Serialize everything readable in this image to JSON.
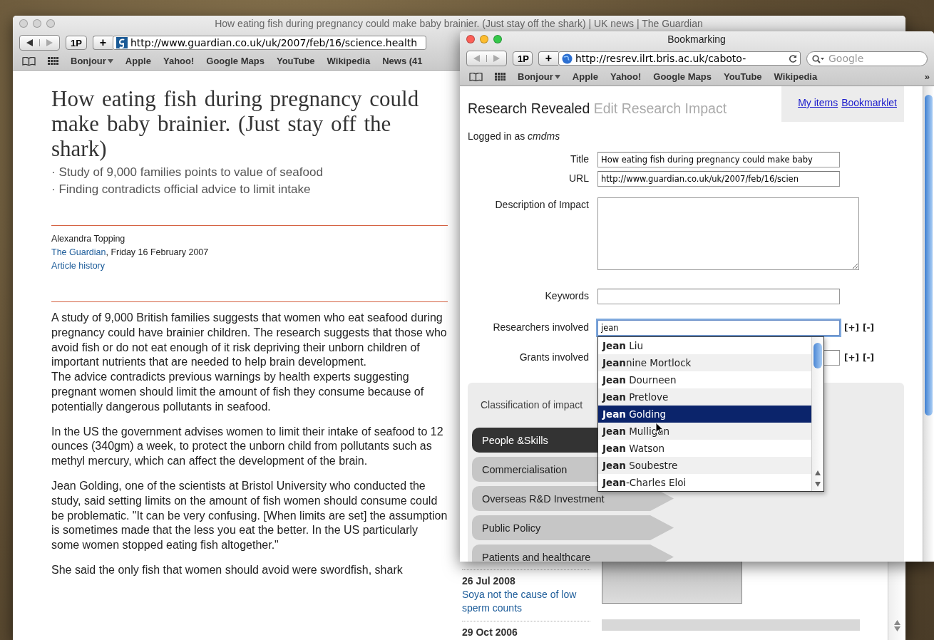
{
  "back_window": {
    "title": "How eating fish during pregnancy could make baby brainier. (Just stay off the shark) | UK news | The Guardian",
    "active": false,
    "toolbar": {
      "password_button": "1P",
      "add_button": "+",
      "url": "http://www.guardian.co.uk/uk/2007/feb/16/science.health",
      "bookmarks": [
        {
          "label": "Bonjour",
          "kind": "menu"
        },
        {
          "label": "Apple",
          "kind": "link"
        },
        {
          "label": "Yahoo!",
          "kind": "link"
        },
        {
          "label": "Google Maps",
          "kind": "link"
        },
        {
          "label": "YouTube",
          "kind": "link"
        },
        {
          "label": "Wikipedia",
          "kind": "link"
        },
        {
          "label": "News (41",
          "kind": "link"
        }
      ]
    },
    "page": {
      "headline": "How eating fish during pregnancy could make baby brainier. (Just stay off the shark)",
      "standfirst": [
        "· Study of 9,000 families points to value of seafood",
        "· Finding contradicts official advice to limit intake"
      ],
      "byline": {
        "author": "Alexandra Topping",
        "publication": "The Guardian",
        "date": ", Friday 16 February 2007",
        "history_link": "Article history"
      },
      "paragraphs": [
        [
          "A study of 9,000 British families suggests that women who eat seafood during pregnancy could have brainier children. The research suggests that those who avoid fish or do not eat enough of it risk depriving their unborn children of important nutrients that are needed to help brain development.",
          "The advice contradicts previous warnings by health experts suggesting pregnant women should limit the amount of fish they consume because of potentially dangerous pollutants in seafood."
        ],
        [
          "In the US the government advises women to limit their intake of seafood to 12 ounces (340gm) a week, to protect the unborn child from pollutants such as methyl mercury, which can affect the development of the brain."
        ],
        [
          "Jean Golding, one of the scientists at Bristol University who conducted the study, said setting limits on the amount of fish women should consume could be problematic. \"It can be very confusing. [When limits are set] the assumption is sometimes made that the less you eat the better. In the US particularly some women stopped eating fish altogether.\""
        ],
        [
          "She said the only fish that women should avoid were swordfish, shark"
        ]
      ],
      "sidebar": [
        {
          "date": "26 Jul 2008",
          "link": "Soya not the cause of low sperm counts"
        },
        {
          "date": "29 Oct 2006"
        }
      ]
    }
  },
  "front_window": {
    "title": "Bookmarking",
    "active": true,
    "toolbar": {
      "password_button": "1P",
      "add_button": "+",
      "url": "http://resrev.ilrt.bris.ac.uk/caboto-",
      "search_placeholder": "Google",
      "bookmarks": [
        {
          "label": "Bonjour",
          "kind": "menu"
        },
        {
          "label": "Apple",
          "kind": "link"
        },
        {
          "label": "Yahoo!",
          "kind": "link"
        },
        {
          "label": "Google Maps",
          "kind": "link"
        },
        {
          "label": "YouTube",
          "kind": "link"
        },
        {
          "label": "Wikipedia",
          "kind": "link"
        }
      ],
      "overflow": "»"
    },
    "page": {
      "site": "Research Revealed",
      "heading": "Edit Research Impact",
      "links": [
        "My items",
        "Bookmarklet"
      ],
      "login": "Logged in as *cmdms*",
      "fields": [
        {
          "label": "Title",
          "kind": "text",
          "value": "How eating fish during pregnancy could make baby"
        },
        {
          "label": "URL",
          "kind": "text",
          "value": "http://www.guardian.co.uk/uk/2007/feb/16/scien"
        },
        {
          "label": "Description of Impact",
          "kind": "textarea"
        },
        {
          "label": "Keywords",
          "kind": "text"
        },
        {
          "label": "Researchers involved",
          "kind": "autocomplete",
          "value": "jean",
          "actions": [
            "[+]",
            "[-]"
          ],
          "options": [
            {
              "label": "**Jean** Liu",
              "selected": false
            },
            {
              "label": "**Jean**nine Mortlock",
              "selected": false
            },
            {
              "label": "**Jean** Dourneen",
              "selected": false
            },
            {
              "label": "**Jean** Pretlove",
              "selected": false
            },
            {
              "label": "**Jean** Golding",
              "selected": true
            },
            {
              "label": "**Jean** Mulligan",
              "selected": false
            },
            {
              "label": "**Jean** Watson",
              "selected": false
            },
            {
              "label": "**Jean** Soubestre",
              "selected": false
            },
            {
              "label": "**Jean**-Charles Eloi",
              "selected": false
            }
          ]
        },
        {
          "label": "Grants involved",
          "kind": "multi",
          "actions": [
            "[+]",
            "[-]"
          ]
        }
      ],
      "classification": {
        "title": "Classification of impact",
        "tabs": [
          {
            "label": "People &Skills",
            "selected": true
          },
          {
            "label": "Commercialisation",
            "selected": false
          },
          {
            "label": "Overseas R&D Investment",
            "selected": false
          },
          {
            "label": "Public Policy",
            "selected": false
          },
          {
            "label": "Patients and healthcare",
            "selected": false
          }
        ]
      }
    }
  }
}
